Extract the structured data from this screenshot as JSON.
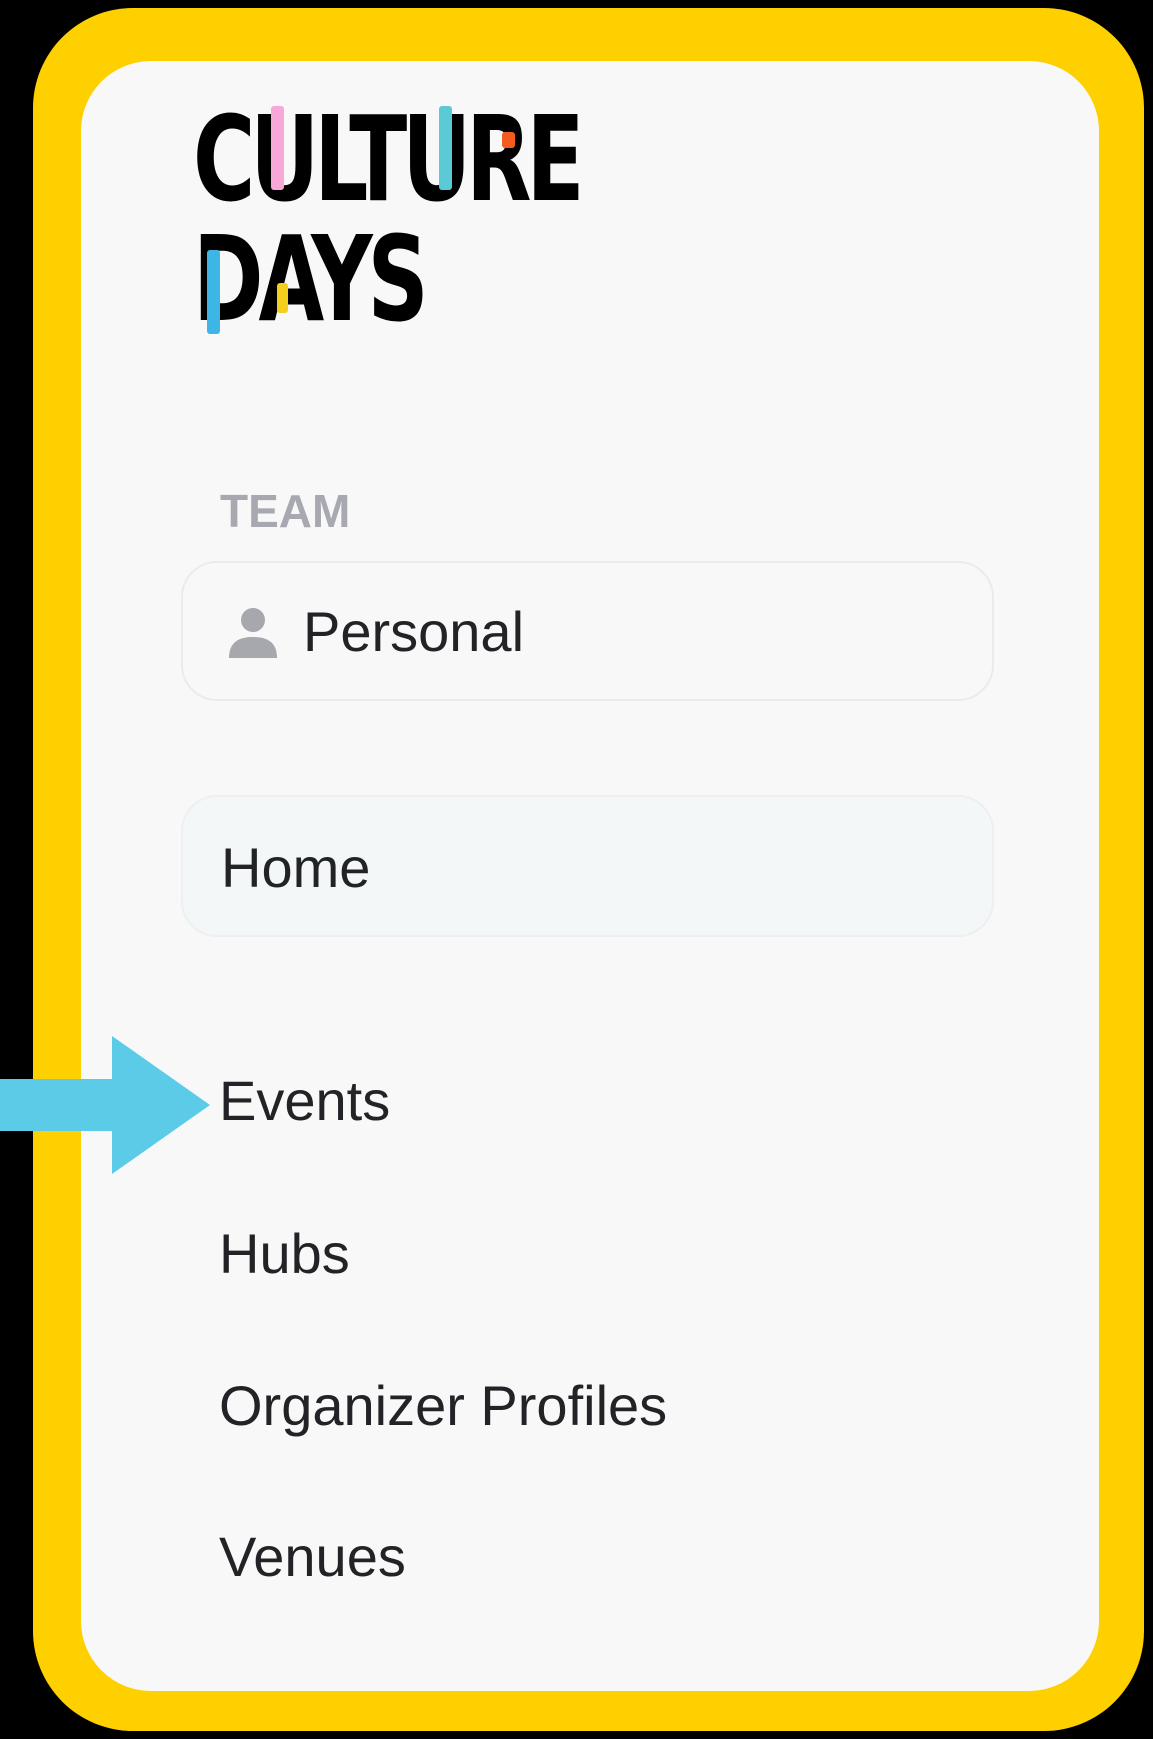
{
  "logo": {
    "line1": "CULTURE",
    "line2": "DAYS",
    "accent_colors": [
      "#F7A8D8",
      "#5CC9D6",
      "#F25C1F",
      "#3DB6E6",
      "#F5CF1D"
    ]
  },
  "frame": {
    "highlight_color": "#FFD000"
  },
  "team": {
    "section_label": "TEAM",
    "selected": "Personal",
    "icon": "person-icon"
  },
  "nav": {
    "items": [
      {
        "label": "Home",
        "active": true
      },
      {
        "label": "Events",
        "active": false
      },
      {
        "label": "Hubs",
        "active": false
      },
      {
        "label": "Organizer Profiles",
        "active": false
      },
      {
        "label": "Venues",
        "active": false
      }
    ]
  },
  "annotation": {
    "icon": "arrow-right-icon",
    "color": "#5BCBE8"
  }
}
